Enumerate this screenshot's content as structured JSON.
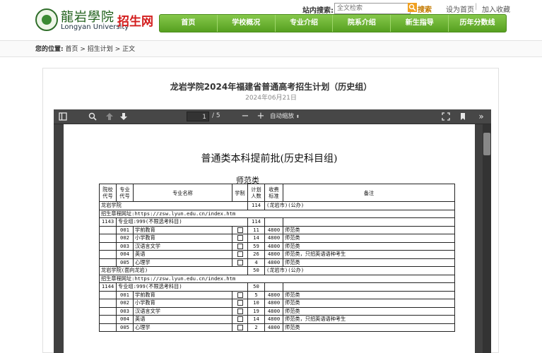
{
  "header": {
    "brand_cn": "龍岩學院",
    "brand_en": "Longyan  University",
    "brand_tag": "招生网",
    "search_label": "站内搜索:",
    "search_placeholder": "全文检索",
    "search_button": "搜索",
    "set_home": "设为首页",
    "add_favorite": "加入收藏"
  },
  "nav": [
    "首页",
    "学校概况",
    "专业介绍",
    "院系介绍",
    "新生指导",
    "历年分数线"
  ],
  "breadcrumb": {
    "label": "您的位置:",
    "items": [
      "首页",
      "招生计划",
      "正文"
    ],
    "separator": ">"
  },
  "article": {
    "title": "龙岩学院2024年福建省普通高考招生计划（历史组）",
    "date": "2024年06月21日"
  },
  "viewer": {
    "page_current": "1",
    "page_total": "/ 5",
    "zoom": "自动缩放"
  },
  "document": {
    "title": "普通类本科提前批(历史科目组)",
    "subtitle": "师范类",
    "headers": {
      "code": "院校代号",
      "major_code": "专业代号",
      "major_name": "专业名称",
      "duration": "学制",
      "plan": "计划人数",
      "fee": "收费标准",
      "note": "备注"
    },
    "blocks": [
      {
        "school": "龙岩学院",
        "school_plan": "114",
        "school_note": "(龙岩市)(公办)",
        "site": "招生章程网址:https://zsw.lyun.edu.cn/index.htm",
        "group_code": "1143",
        "group_name": "专业组:999(不限选考科目)",
        "group_plan": "114",
        "rows": [
          {
            "code": "001",
            "name": "学前教育",
            "plan": "11",
            "fee": "4800",
            "note": "师范类"
          },
          {
            "code": "002",
            "name": "小学教育",
            "plan": "14",
            "fee": "4800",
            "note": "师范类"
          },
          {
            "code": "003",
            "name": "汉语言文学",
            "plan": "59",
            "fee": "4800",
            "note": "师范类"
          },
          {
            "code": "004",
            "name": "英语",
            "plan": "26",
            "fee": "4800",
            "note": "师范类，只招英语语种考生"
          },
          {
            "code": "005",
            "name": "心理学",
            "plan": "4",
            "fee": "4800",
            "note": "师范类"
          }
        ]
      },
      {
        "school": "龙岩学院(面向龙岩)",
        "school_plan": "50",
        "school_note": "(龙岩市)(公办)",
        "site": "招生章程网址:https://zsw.lyun.edu.cn/index.htm",
        "group_code": "1144",
        "group_name": "专业组:999(不限选考科目)",
        "group_plan": "50",
        "rows": [
          {
            "code": "001",
            "name": "学前教育",
            "plan": "5",
            "fee": "4800",
            "note": "师范类"
          },
          {
            "code": "002",
            "name": "小学教育",
            "plan": "10",
            "fee": "4800",
            "note": "师范类"
          },
          {
            "code": "003",
            "name": "汉语言文学",
            "plan": "19",
            "fee": "4800",
            "note": "师范类"
          },
          {
            "code": "004",
            "name": "英语",
            "plan": "14",
            "fee": "4800",
            "note": "师范类，只招英语语种考生"
          },
          {
            "code": "005",
            "name": "心理学",
            "plan": "2",
            "fee": "4800",
            "note": "师范类"
          }
        ]
      }
    ]
  },
  "colors": {
    "nav_green": "#56a020",
    "brand_red": "#d31d1d",
    "search_orange": "#c47a00"
  }
}
